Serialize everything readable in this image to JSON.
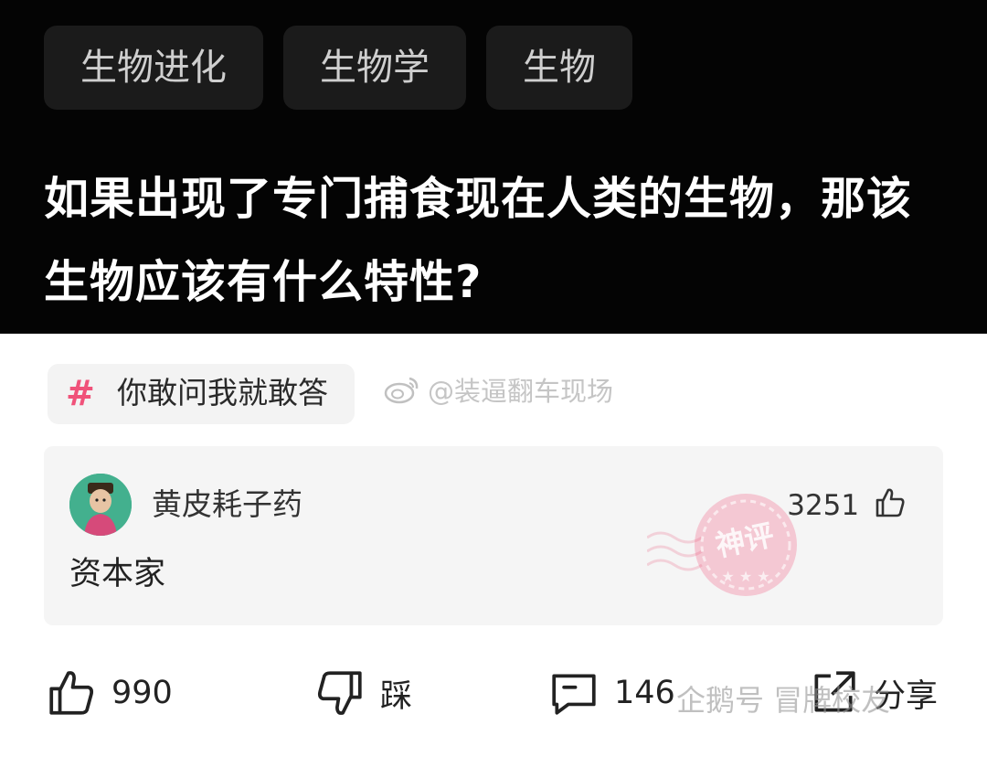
{
  "tags": [
    "生物进化",
    "生物学",
    "生物"
  ],
  "question": "如果出现了专门捕食现在人类的生物，那该生物应该有什么特性?",
  "topic": {
    "hash": "#",
    "label": "你敢问我就敢答"
  },
  "watermark_top": "@装逼翻车现场",
  "comment": {
    "username": "黄皮耗子药",
    "likes": "3251",
    "content": "资本家",
    "stamp_text": "神评"
  },
  "actions": {
    "like_count": "990",
    "dislike_label": "踩",
    "comment_count": "146",
    "share_label": "分享"
  },
  "watermark_bottom": "企鹅号 冒牌校友",
  "colors": {
    "accent": "#f0527a",
    "stamp": "#e8557a",
    "header_bg": "#040404"
  }
}
